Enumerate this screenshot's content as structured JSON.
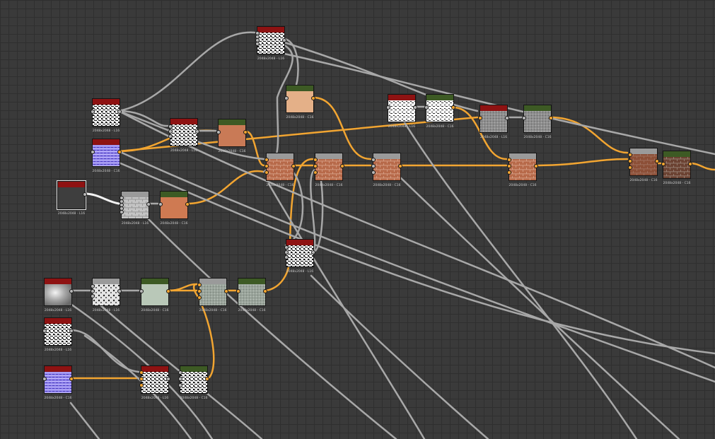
{
  "graph": {
    "colors": {
      "wire_gray": "#a8a8a8",
      "wire_orange": "#f2a531",
      "wire_white": "#f2f2f2",
      "header_red": "#8e1212",
      "header_green": "#3d5a24",
      "header_gray": "#9a9a9a"
    },
    "nodes": [
      {
        "id": "n_noise_top",
        "label": "2048x2048 - L16",
        "header": "red",
        "thumb": "noise-bw",
        "icon": "grayscale-noise-icon"
      },
      {
        "id": "n_bw1",
        "label": "2048x2048 - L16",
        "header": "red",
        "thumb": "noise-bw",
        "icon": "grayscale-noise-icon"
      },
      {
        "id": "n_blue",
        "label": "2048x2048 - C16",
        "header": "red",
        "thumb": "blue-lines",
        "icon": "color-noise-icon"
      },
      {
        "id": "n_bw2",
        "label": "2048x2048 - L16",
        "header": "red",
        "thumb": "noise-bw",
        "icon": "grayscale-noise-icon"
      },
      {
        "id": "n_tan",
        "label": "2048x2048 - C16",
        "header": "green",
        "thumb": "tan",
        "icon": "color-fill-icon"
      },
      {
        "id": "n_clay",
        "label": "2048x2048 - C16",
        "header": "green",
        "thumb": "clay",
        "icon": "color-fill-icon"
      },
      {
        "id": "n_dark",
        "label": "2048x2048 - L16",
        "header": "red",
        "thumb": "dark",
        "icon": "grunge-icon",
        "selected": true
      },
      {
        "id": "n_brick",
        "label": "2048x2048 - L16",
        "header": "gray",
        "thumb": "bricks-gray",
        "icon": "brick-pattern-icon"
      },
      {
        "id": "n_orange1",
        "label": "2048x2048 - C16",
        "header": "green",
        "thumb": "orange",
        "icon": "color-fill-icon"
      },
      {
        "id": "n_mix1",
        "label": "2048x2048 - C16",
        "header": "gray",
        "thumb": "brick-color",
        "icon": "blend-icon"
      },
      {
        "id": "n_mix2",
        "label": "2048x2048 - C16",
        "header": "gray",
        "thumb": "brick-color",
        "icon": "blend-icon"
      },
      {
        "id": "n_mix3",
        "label": "2048x2048 - C16",
        "header": "gray",
        "thumb": "brick-color",
        "icon": "blend-icon"
      },
      {
        "id": "n_bw3",
        "label": "2048x2048 - L16",
        "header": "red",
        "thumb": "noise-bw-light",
        "icon": "grayscale-noise-icon"
      },
      {
        "id": "n_bw4",
        "label": "2048x2048 - C16",
        "header": "green",
        "thumb": "noise-bw-light",
        "icon": "color-noise-icon"
      },
      {
        "id": "n_gray1",
        "label": "2048x2048 - L16",
        "header": "red",
        "thumb": "gray-noise",
        "icon": "grayscale-noise-icon"
      },
      {
        "id": "n_gray2",
        "label": "2048x2048 - C16",
        "header": "green",
        "thumb": "gray-noise",
        "icon": "color-noise-icon"
      },
      {
        "id": "n_mix4",
        "label": "2048x2048 - C16",
        "header": "gray",
        "thumb": "brick-color",
        "icon": "blend-icon"
      },
      {
        "id": "n_mix5",
        "label": "2048x2048 - C16",
        "header": "gray",
        "thumb": "brick-color-dark",
        "icon": "blend-icon"
      },
      {
        "id": "n_final",
        "label": "2048x2048 - C16",
        "header": "green",
        "thumb": "brick-dark",
        "icon": "output-icon"
      },
      {
        "id": "n_bw5",
        "label": "2048x2048 - L16",
        "header": "red",
        "thumb": "noise-bw",
        "icon": "grayscale-noise-icon"
      },
      {
        "id": "n_cloud",
        "label": "2048x2048 - L16",
        "header": "red",
        "thumb": "clouds",
        "icon": "cloud-noise-icon"
      },
      {
        "id": "n_cells",
        "label": "2048x2048 - L16",
        "header": "gray",
        "thumb": "spots",
        "icon": "cells-noise-icon"
      },
      {
        "id": "n_greentex",
        "label": "2048x2048 - C16",
        "header": "green",
        "thumb": "pale-green",
        "icon": "color-fill-icon"
      },
      {
        "id": "n_graytex",
        "label": "2048x2048 - C16",
        "header": "gray",
        "thumb": "gray-green",
        "icon": "blend-icon"
      },
      {
        "id": "n_graytex2",
        "label": "2048x2048 - C16",
        "header": "green",
        "thumb": "gray-green",
        "icon": "color-fill-icon"
      },
      {
        "id": "n_bw6",
        "label": "2048x2048 - L16",
        "header": "red",
        "thumb": "noise-bw",
        "icon": "grayscale-noise-icon"
      },
      {
        "id": "n_blue2",
        "label": "2048x2048 - C16",
        "header": "red",
        "thumb": "blue-lines",
        "icon": "color-noise-icon"
      },
      {
        "id": "n_bw7",
        "label": "2048x2048 - L16",
        "header": "red",
        "thumb": "noise-bw",
        "icon": "grayscale-noise-icon"
      },
      {
        "id": "n_bw8",
        "label": "2048x2048 - C16",
        "header": "green",
        "thumb": "noise-bw",
        "icon": "color-noise-icon"
      }
    ]
  }
}
